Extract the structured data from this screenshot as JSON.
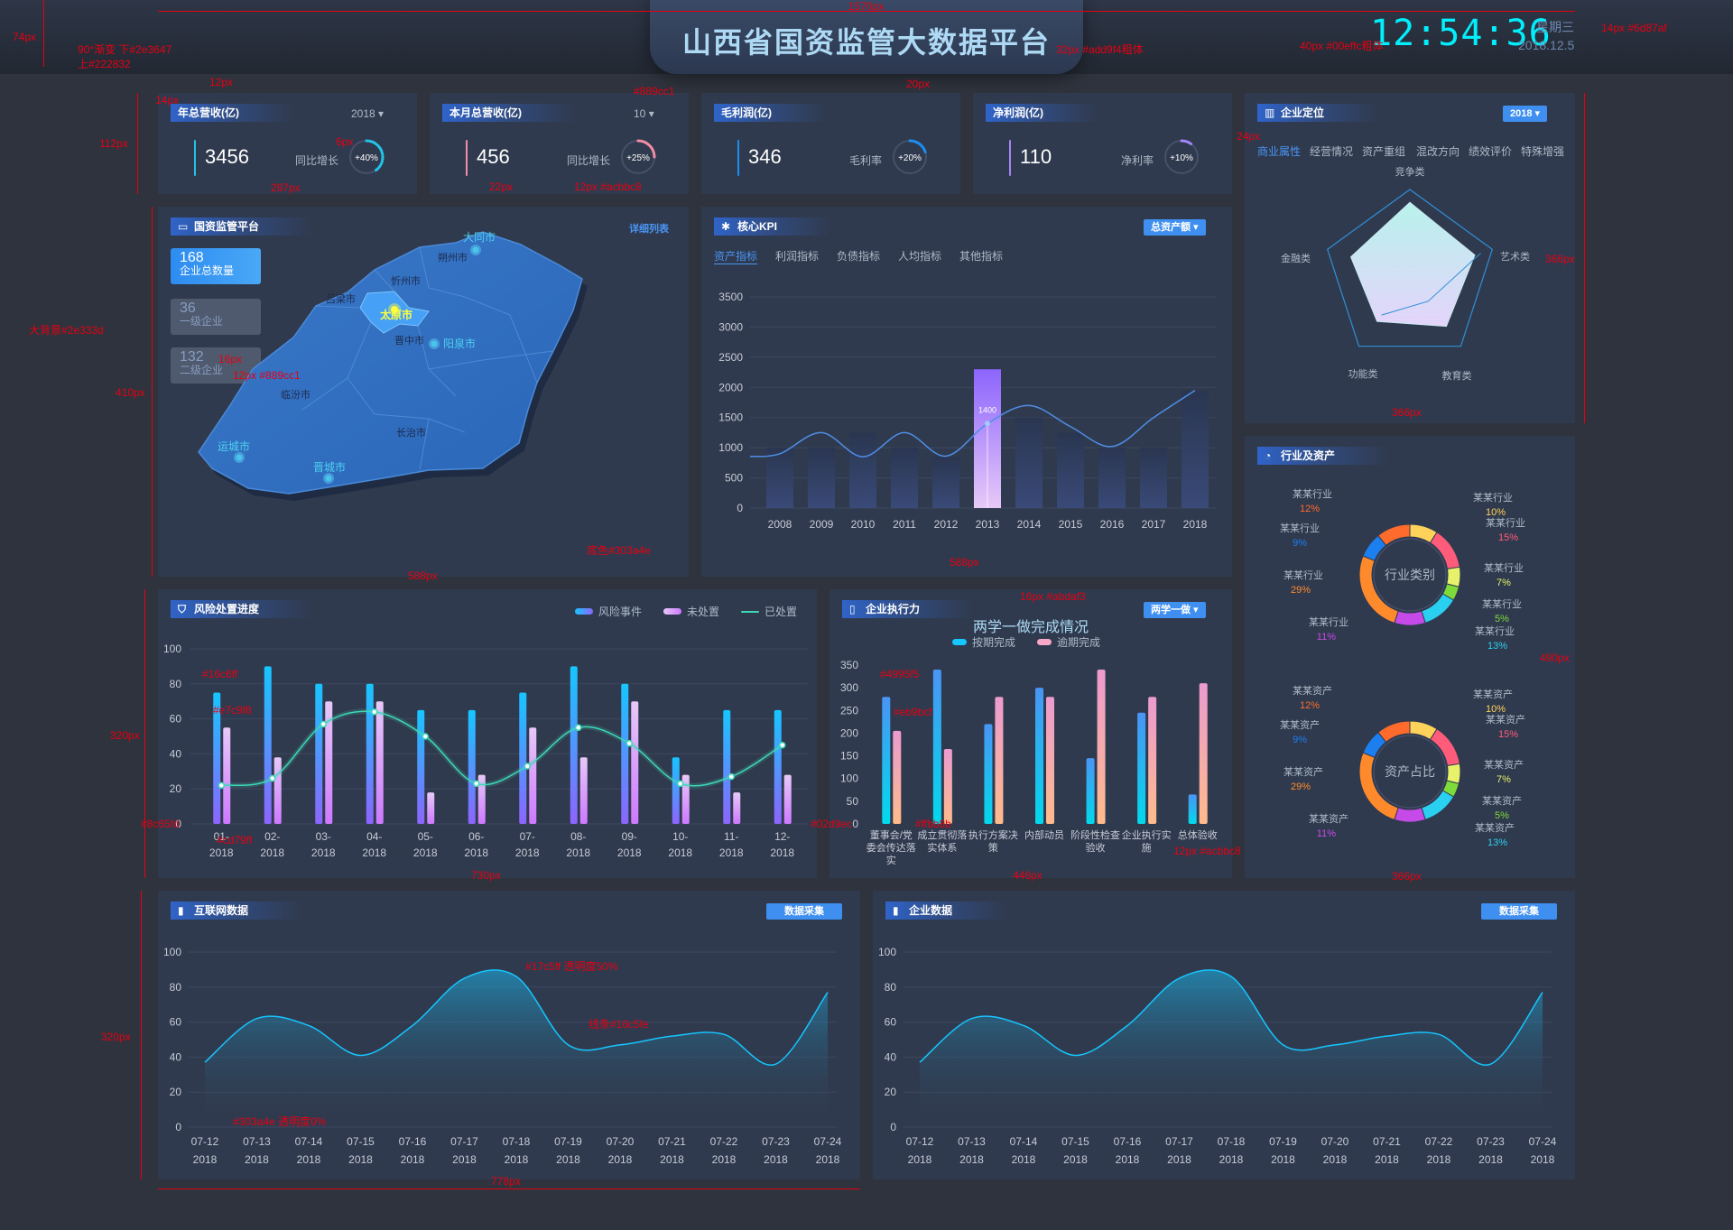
{
  "header": {
    "title": "山西省国资监管大数据平台",
    "clock": "12:54:36",
    "weekday": "星期三",
    "date": "2018.12.5"
  },
  "colors": {
    "bg": "#2e333d",
    "panel": "#303a4e",
    "accent": "#00effc",
    "title": "#add9f4",
    "subtext": "#acbbc8",
    "meta": "#6d87af"
  },
  "stats": [
    {
      "label": "年总营收(亿)",
      "value": "3456",
      "year": "2018",
      "sub_label": "同比增长",
      "percent": "+40%",
      "ratio": 0.4,
      "color": "#22c3e8"
    },
    {
      "label": "本月总营收(亿)",
      "value": "456",
      "year": "10",
      "sub_label": "同比增长",
      "percent": "+25%",
      "ratio": 0.25,
      "color": "#f28da6"
    },
    {
      "label": "毛利润(亿)",
      "value": "346",
      "year": "",
      "sub_label": "毛利率",
      "percent": "+20%",
      "ratio": 0.2,
      "color": "#1b8ff0"
    },
    {
      "label": "净利润(亿)",
      "value": "110",
      "year": "",
      "sub_label": "净利率",
      "percent": "+10%",
      "ratio": 0.1,
      "color": "#a486f5"
    }
  ],
  "map_panel": {
    "title": "国资监管平台",
    "link": "详细列表",
    "cards": [
      {
        "value": "168",
        "label": "企业总数量"
      },
      {
        "value": "36",
        "label": "一级企业"
      },
      {
        "value": "132",
        "label": "二级企业"
      }
    ],
    "cities_major": [
      "大同市",
      "太原市",
      "阳泉市",
      "运城市",
      "晋城市"
    ],
    "cities_minor": [
      "朔州市",
      "忻州市",
      "吕梁市",
      "晋中市",
      "临汾市",
      "长治市"
    ]
  },
  "kpi": {
    "title": "核心KPI",
    "dropdown": "总资产额",
    "tabs": [
      "资产指标",
      "利润指标",
      "负债指标",
      "人均指标",
      "其他指标"
    ],
    "highlight_label": "1400"
  },
  "position": {
    "title": "企业定位",
    "year": "2018",
    "tabs": [
      "商业属性",
      "经营情况",
      "资产重组",
      "混改方向",
      "绩效评价",
      "特殊增强"
    ],
    "radar_labels": [
      "竞争类",
      "艺术类",
      "教育类",
      "功能类",
      "金融类"
    ]
  },
  "industry": {
    "title": "行业及资产",
    "donut1_center": "行业类别",
    "donut2_center": "资产占比",
    "d1_labels": [
      {
        "name": "某某行业",
        "pct": "12%",
        "color": "#ff6b2c"
      },
      {
        "name": "某某行业",
        "pct": "10%",
        "color": "#ffd25a"
      },
      {
        "name": "某某行业",
        "pct": "9%",
        "color": "#1b7ff0"
      },
      {
        "name": "某某行业",
        "pct": "15%",
        "color": "#ff5b7a"
      },
      {
        "name": "某某行业",
        "pct": "29%",
        "color": "#ff8a2c"
      },
      {
        "name": "某某行业",
        "pct": "7%",
        "color": "#e7f26a"
      },
      {
        "name": "某某行业",
        "pct": "5%",
        "color": "#7edc3a"
      },
      {
        "name": "某某行业",
        "pct": "11%",
        "color": "#c54ae8"
      },
      {
        "name": "某某行业",
        "pct": "13%",
        "color": "#2ad0f0"
      }
    ],
    "d2_labels": [
      {
        "name": "某某资产",
        "pct": "12%",
        "color": "#ff6b2c"
      },
      {
        "name": "某某资产",
        "pct": "10%",
        "color": "#ffd25a"
      },
      {
        "name": "某某资产",
        "pct": "9%",
        "color": "#1b7ff0"
      },
      {
        "name": "某某资产",
        "pct": "15%",
        "color": "#ff5b7a"
      },
      {
        "name": "某某资产",
        "pct": "29%",
        "color": "#ff8a2c"
      },
      {
        "name": "某某资产",
        "pct": "7%",
        "color": "#e7f26a"
      },
      {
        "name": "某某资产",
        "pct": "5%",
        "color": "#7edc3a"
      },
      {
        "name": "某某资产",
        "pct": "11%",
        "color": "#c54ae8"
      },
      {
        "name": "某某资产",
        "pct": "13%",
        "color": "#2ad0f0"
      }
    ]
  },
  "risk": {
    "title": "风险处置进度",
    "legend": [
      "风险事件",
      "未处置",
      "已处置"
    ]
  },
  "exec": {
    "title": "企业执行力",
    "dropdown": "两学一做",
    "chart_title": "两学一做完成情况",
    "legend": [
      "按期完成",
      "逾期完成"
    ]
  },
  "internet": {
    "title": "互联网数据",
    "button": "数据采集"
  },
  "enterprise": {
    "title": "企业数据",
    "button": "数据采集"
  },
  "chart_data": [
    {
      "type": "bar",
      "id": "kpi",
      "categories": [
        "2008",
        "2009",
        "2010",
        "2011",
        "2012",
        "2013",
        "2014",
        "2015",
        "2016",
        "2017",
        "2018"
      ],
      "series": [
        {
          "values": [
            1000,
            1000,
            1250,
            1000,
            850,
            2300,
            1500,
            1250,
            1000,
            1000,
            1950
          ]
        },
        {
          "values": [
            900,
            1250,
            850,
            1250,
            860,
            1400,
            1700,
            1350,
            1020,
            1500,
            1950
          ]
        }
      ],
      "ylim": [
        0,
        3500
      ],
      "yticks": [
        0,
        500,
        1000,
        1500,
        2000,
        2500,
        3000,
        3500
      ]
    },
    {
      "type": "radar",
      "id": "position",
      "labels": [
        "竞争类",
        "艺术类",
        "教育类",
        "功能类",
        "金融类"
      ],
      "values": [
        0.95,
        0.88,
        0.8,
        0.72,
        0.8
      ]
    },
    {
      "type": "bar",
      "id": "risk",
      "categories": [
        "01-2018",
        "02-2018",
        "03-2018",
        "04-2018",
        "05-2018",
        "06-2018",
        "07-2018",
        "08-2018",
        "09-2018",
        "10-2018",
        "11-2018",
        "12-2018"
      ],
      "series": [
        {
          "name": "风险事件",
          "values": [
            75,
            90,
            80,
            80,
            65,
            65,
            75,
            90,
            80,
            38,
            65,
            65
          ]
        },
        {
          "name": "未处置",
          "values": [
            55,
            38,
            70,
            70,
            18,
            28,
            55,
            38,
            70,
            28,
            18,
            28
          ]
        },
        {
          "name": "已处置",
          "values": [
            22,
            26,
            57,
            64,
            50,
            23,
            33,
            55,
            46,
            23,
            27,
            45
          ]
        }
      ],
      "ylim": [
        0,
        100
      ],
      "yticks": [
        0,
        20,
        40,
        60,
        80,
        100
      ]
    },
    {
      "type": "bar",
      "id": "exec",
      "categories": [
        "董事会/党委会传达落实",
        "成立贯彻落实体系",
        "执行方案决策",
        "内部动员",
        "阶段性检查验收",
        "企业执行实施",
        "总体验收"
      ],
      "series": [
        {
          "name": "按期完成",
          "values": [
            280,
            340,
            220,
            300,
            145,
            245,
            65
          ]
        },
        {
          "name": "逾期完成",
          "values": [
            205,
            165,
            280,
            280,
            340,
            280,
            310
          ]
        }
      ],
      "ylim": [
        0,
        350
      ],
      "yticks": [
        0,
        50,
        100,
        150,
        200,
        250,
        300,
        350
      ]
    },
    {
      "type": "area",
      "id": "internet",
      "x": [
        "07-12",
        "07-13",
        "07-14",
        "07-15",
        "07-16",
        "07-17",
        "07-18",
        "07-19",
        "07-20",
        "07-21",
        "07-22",
        "07-23",
        "07-24"
      ],
      "xsub": "2018",
      "values": [
        37,
        62,
        58,
        41,
        58,
        85,
        86,
        47,
        47,
        52,
        53,
        36,
        77
      ],
      "ylim": [
        0,
        100
      ],
      "yticks": [
        0,
        20,
        40,
        60,
        80,
        100
      ]
    },
    {
      "type": "area",
      "id": "enterprise",
      "x": [
        "07-12",
        "07-13",
        "07-14",
        "07-15",
        "07-16",
        "07-17",
        "07-18",
        "07-19",
        "07-20",
        "07-21",
        "07-22",
        "07-23",
        "07-24"
      ],
      "xsub": "2018",
      "values": [
        37,
        62,
        58,
        41,
        58,
        85,
        86,
        47,
        47,
        52,
        53,
        36,
        77
      ],
      "ylim": [
        0,
        100
      ],
      "yticks": [
        0,
        20,
        40,
        60,
        80,
        100
      ]
    }
  ],
  "annotations": [
    "1570px",
    "74px",
    "90°渐变 下#2e3647",
    "上#222832",
    "32px #add9f4粗体",
    "40px #00effc粗体",
    "14px #6d87af",
    "20px",
    "12px",
    "14px",
    "112px",
    "287px",
    "6px",
    "22px",
    "12px #acbbc8",
    "#889cc1",
    "24px",
    "366px",
    "410px",
    "588px",
    "16px",
    "12px #889cc1",
    "大背景#2e333d",
    "底色#303a4e",
    "320px",
    "#16c6ff",
    "#e7c9f8",
    "#8c65fd",
    "#cd79ff",
    "730px",
    "16px #abdaf3",
    "#4995f5",
    "#eb9bcf",
    "#02d9ec",
    "#ffbb8b",
    "12px #acbbc8",
    "446px",
    "490px",
    "320px",
    "#17c5ff 透明度50%",
    "线条#16c5fe",
    "#303a4e 透明度0%",
    "778px"
  ]
}
